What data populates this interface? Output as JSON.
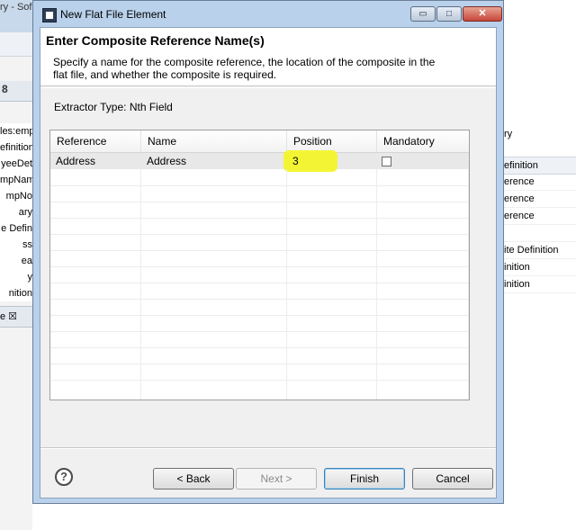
{
  "background": {
    "left_title_fragment": "ry - Sof",
    "left_tab_fragment": "8",
    "left_tree": [
      "les:emp",
      "efinition",
      "yeeDet",
      "mpNam",
      "mpNo",
      "ary",
      "e Defin",
      "ss",
      "ea",
      "y",
      "nition"
    ],
    "left_tab2": "e ☒",
    "right_top": "ry",
    "right_header": "efinition",
    "right_list": [
      "erence",
      "erence",
      "erence",
      "",
      "ite Definition",
      "inition",
      "inition"
    ]
  },
  "dialog": {
    "title": "New Flat File Element",
    "window_buttons": {
      "minimize": "▭",
      "maximize": "□",
      "close": "✕"
    },
    "heading": "Enter Composite Reference Name(s)",
    "description": "Specify a name for the composite reference, the location of the composite in the flat file, and whether the composite is required.",
    "extractor_label": "Extractor Type: Nth Field",
    "table": {
      "columns": [
        "Reference",
        "Name",
        "Position",
        "Mandatory"
      ],
      "rows": [
        {
          "reference": "Address",
          "name": "Address",
          "position": "3",
          "mandatory": false
        }
      ]
    },
    "buttons": {
      "help": "?",
      "back": "< Back",
      "next": "Next >",
      "finish": "Finish",
      "cancel": "Cancel"
    }
  },
  "colors": {
    "highlight": "#f3f62a",
    "dialog_frame": "#b9d1ea",
    "selected_row": "#e8e8e8"
  }
}
